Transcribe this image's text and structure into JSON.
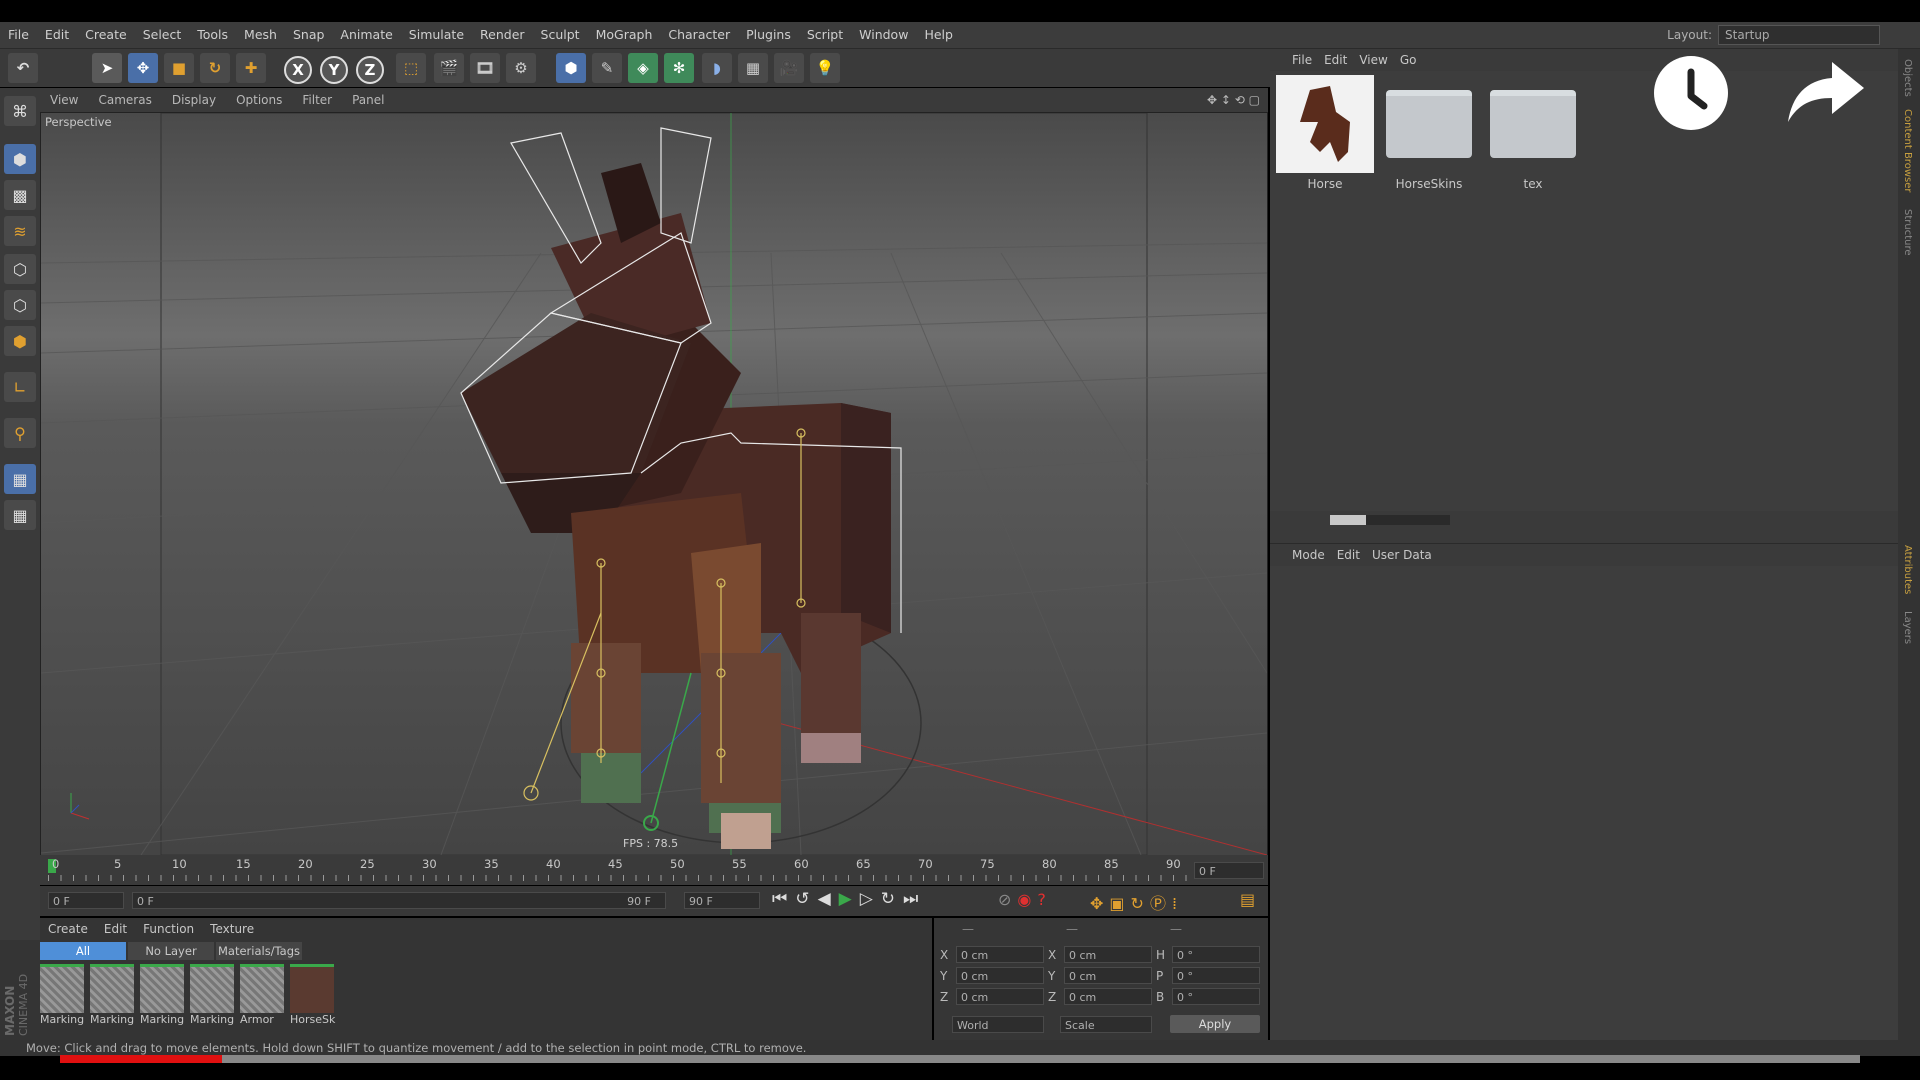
{
  "app": {
    "brand_line1": "MAXON",
    "brand_line2": "CINEMA 4D"
  },
  "menu": [
    "File",
    "Edit",
    "Create",
    "Select",
    "Tools",
    "Mesh",
    "Snap",
    "Animate",
    "Simulate",
    "Render",
    "Sculpt",
    "MoGraph",
    "Character",
    "Plugins",
    "Script",
    "Window",
    "Help"
  ],
  "layout": {
    "label": "Layout:",
    "value": "Startup"
  },
  "toolbar": {
    "axis_x": "X",
    "axis_y": "Y",
    "axis_z": "Z"
  },
  "viewport": {
    "menu": [
      "View",
      "Cameras",
      "Display",
      "Options",
      "Filter",
      "Panel"
    ],
    "camera_label": "Perspective",
    "fps": "FPS : 78.5"
  },
  "timeline": {
    "ticks": [
      "0",
      "5",
      "10",
      "15",
      "20",
      "25",
      "30",
      "35",
      "40",
      "45",
      "50",
      "55",
      "60",
      "65",
      "70",
      "75",
      "80",
      "85",
      "90"
    ],
    "current_frame": "0 F"
  },
  "transport": {
    "start_field": "0 F",
    "range_start": "0 F",
    "range_end": "90 F",
    "end_field": "90 F"
  },
  "materials": {
    "menu": [
      "Create",
      "Edit",
      "Function",
      "Texture"
    ],
    "filters": [
      "All",
      "No Layer",
      "Materials/Tags"
    ],
    "items": [
      {
        "label": "Marking",
        "kind": "pattern"
      },
      {
        "label": "Marking",
        "kind": "pattern"
      },
      {
        "label": "Marking",
        "kind": "pattern"
      },
      {
        "label": "Marking",
        "kind": "pattern"
      },
      {
        "label": "Armor",
        "kind": "pattern"
      },
      {
        "label": "HorseSk",
        "kind": "texture"
      }
    ]
  },
  "coordinates": {
    "headers": [
      "—",
      "—",
      "—"
    ],
    "rows": [
      {
        "a": "X",
        "av": "0 cm",
        "b": "X",
        "bv": "0 cm",
        "c": "H",
        "cv": "0 °"
      },
      {
        "a": "Y",
        "av": "0 cm",
        "b": "Y",
        "bv": "0 cm",
        "c": "P",
        "cv": "0 °"
      },
      {
        "a": "Z",
        "av": "0 cm",
        "b": "Z",
        "bv": "0 cm",
        "c": "B",
        "cv": "0 °"
      }
    ],
    "mode": "World",
    "scale": "Scale",
    "apply": "Apply"
  },
  "content_browser": {
    "menu": [
      "File",
      "Edit",
      "View",
      "Go"
    ],
    "items": [
      {
        "label": "Horse",
        "kind": "image"
      },
      {
        "label": "HorseSkins",
        "kind": "folder"
      },
      {
        "label": "tex",
        "kind": "folder"
      }
    ]
  },
  "attributes": {
    "menu": [
      "Mode",
      "Edit",
      "User Data"
    ]
  },
  "side_tabs": {
    "top": [
      "Objects",
      "Content Browser",
      "Structure"
    ],
    "bottom": [
      "Attributes",
      "Layers"
    ]
  },
  "status": {
    "text": "Move: Click and drag to move elements. Hold down SHIFT to quantize movement / add to the selection in point mode, CTRL to remove."
  },
  "progress": {
    "fraction": 0.09
  },
  "colors": {
    "accent_blue": "#4f8fd8",
    "progress_red": "#e01010",
    "highlight_orange": "#e0a030"
  },
  "overlay_icons": [
    "clock-icon",
    "share-arrow-icon"
  ]
}
